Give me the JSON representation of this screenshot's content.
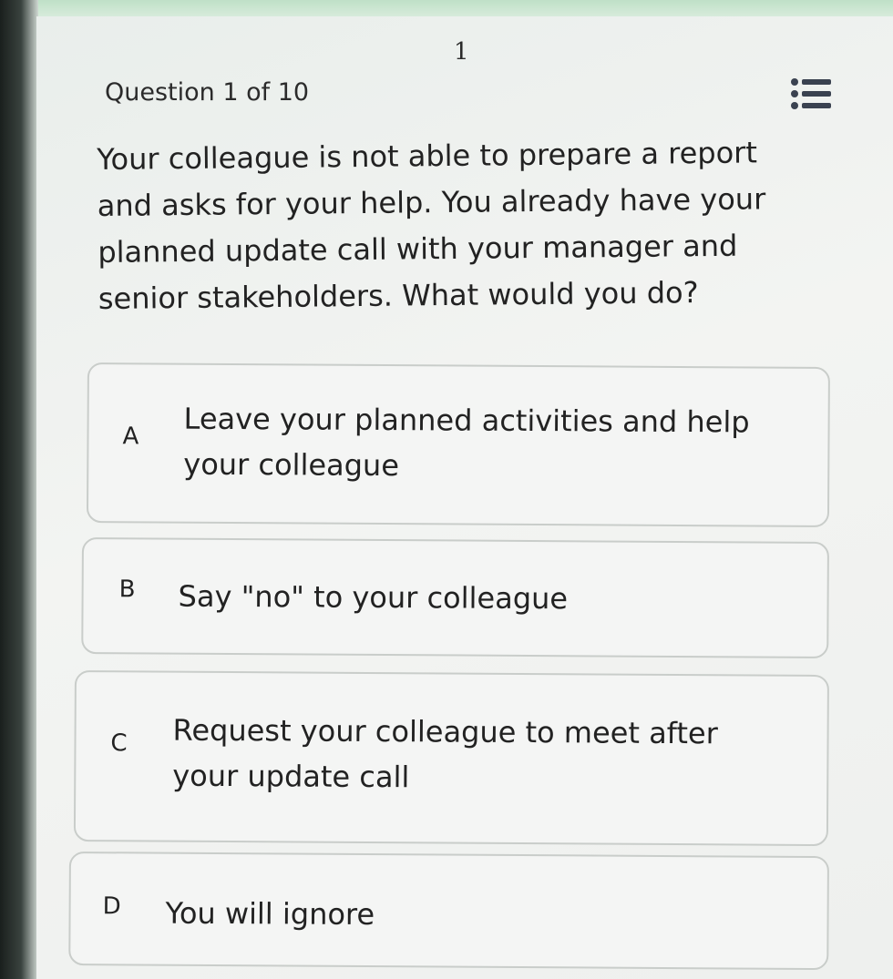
{
  "header": {
    "page_number": "1",
    "question_counter": "Question 1 of 10",
    "list_icon": "list-icon"
  },
  "question": {
    "text": "Your colleague is not able to prepare a report and asks for your help. You already have your planned update call with your manager and senior stakeholders. What would you do?"
  },
  "options": [
    {
      "letter": "A",
      "text": "Leave your planned activities and help your colleague"
    },
    {
      "letter": "B",
      "text": "Say \"no\" to your colleague"
    },
    {
      "letter": "C",
      "text": "Request your colleague to meet after your update call"
    },
    {
      "letter": "D",
      "text": "You will ignore"
    }
  ],
  "colors": {
    "accent": "#3a4250",
    "text": "#222222",
    "card_border": "#c9cdca"
  }
}
